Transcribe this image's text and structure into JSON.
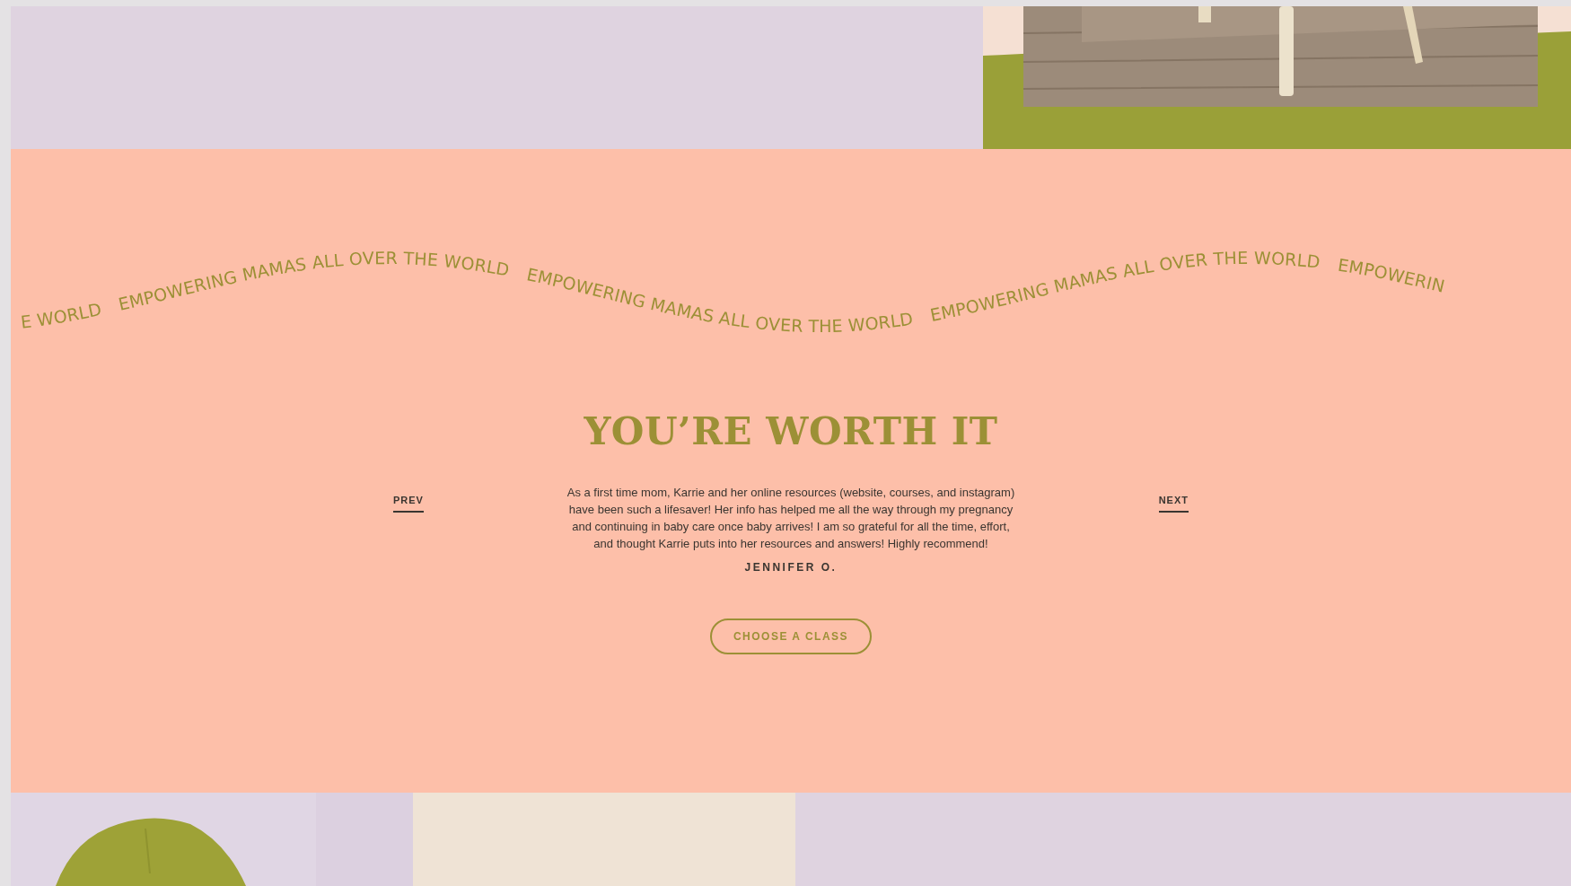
{
  "testimonials": {
    "marquee": [
      "E WORLD",
      "EMPOWERING MAMAS ALL OVER THE WORLD",
      "EMPOWERING MAMAS ALL OVER THE WORLD",
      "EMPOWERING MAMAS ALL OVER THE WORLD",
      "EMPOWERIN"
    ],
    "heading": "YOU’RE WORTH IT",
    "prev": "PREV",
    "next": "NEXT",
    "quote": "As a first time mom, Karrie and her online resources (website, courses, and instagram) have been such a lifesaver! Her info has helped me all the way through my pregnancy and continuing in baby care once baby arrives! I am so grateful for all the time, effort, and thought Karrie puts into her resources and answers! Highly recommend!",
    "author": "JENNIFER O.",
    "button": "CHOOSE A CLASS"
  }
}
